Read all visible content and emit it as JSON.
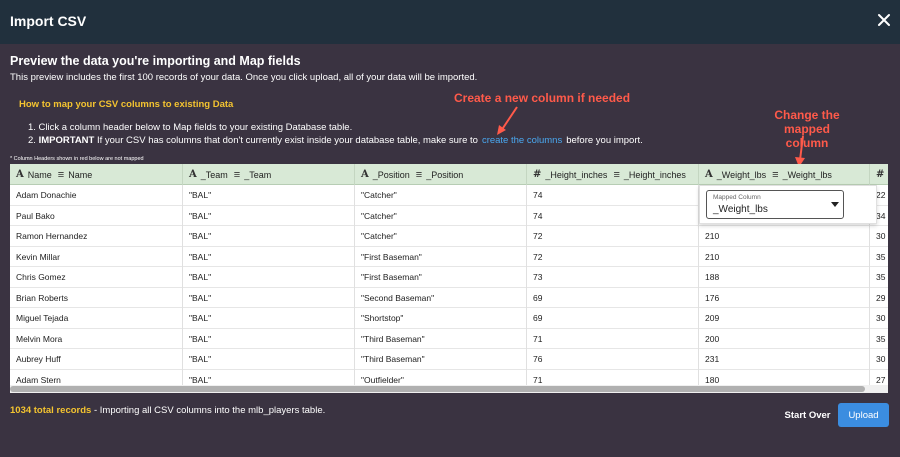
{
  "window": {
    "title": "Import CSV"
  },
  "header": {
    "heading": "Preview the data you're importing and Map fields",
    "subheading": "This preview includes the first 100 records of your data. Once you click upload, all of your data will be imported."
  },
  "instructions": {
    "title": "How to map your CSV columns to existing Data",
    "step1": "1. Click a column header below to Map fields to your existing Database table.",
    "step2_prefix": "2.",
    "step2_bold": "IMPORTANT",
    "step2_text": "If your CSV has columns that don't currently exist inside your database table, make sure to",
    "step2_link": "create the columns",
    "step2_suffix": "before you import.",
    "note": "* Column Headers shown in red below are not mapped"
  },
  "annotations": {
    "create_column": "Create a new column if needed",
    "change_mapped_line1": "Change the",
    "change_mapped_line2": "mapped column",
    "accent_color": "#ff5a4a"
  },
  "table": {
    "columns": [
      {
        "type_icon": "A",
        "name": "Name",
        "mapped": "Name"
      },
      {
        "type_icon": "A",
        "name": "_Team",
        "mapped": "_Team"
      },
      {
        "type_icon": "A",
        "name": "_Position",
        "mapped": "_Position"
      },
      {
        "type_icon": "#",
        "name": "_Height_inches",
        "mapped": "_Height_inches"
      },
      {
        "type_icon": "A",
        "name": "_Weight_lbs",
        "mapped": "_Weight_lbs"
      },
      {
        "type_icon": "#",
        "name": "",
        "mapped": ""
      }
    ],
    "rows": [
      [
        "Adam Donachie",
        "\"BAL\"",
        "\"Catcher\"",
        "74",
        "",
        "22"
      ],
      [
        "Paul Bako",
        "\"BAL\"",
        "\"Catcher\"",
        "74",
        "",
        "34"
      ],
      [
        "Ramon Hernandez",
        "\"BAL\"",
        "\"Catcher\"",
        "72",
        "210",
        "30"
      ],
      [
        "Kevin Millar",
        "\"BAL\"",
        "\"First Baseman\"",
        "72",
        "210",
        "35"
      ],
      [
        "Chris Gomez",
        "\"BAL\"",
        "\"First Baseman\"",
        "73",
        "188",
        "35"
      ],
      [
        "Brian Roberts",
        "\"BAL\"",
        "\"Second Baseman\"",
        "69",
        "176",
        "29"
      ],
      [
        "Miguel Tejada",
        "\"BAL\"",
        "\"Shortstop\"",
        "69",
        "209",
        "30"
      ],
      [
        "Melvin Mora",
        "\"BAL\"",
        "\"Third Baseman\"",
        "71",
        "200",
        "35"
      ],
      [
        "Aubrey Huff",
        "\"BAL\"",
        "\"Third Baseman\"",
        "76",
        "231",
        "30"
      ],
      [
        "Adam Stern",
        "\"BAL\"",
        "\"Outfielder\"",
        "71",
        "180",
        "27"
      ]
    ],
    "header_bg": "#d8e9d6"
  },
  "mapping_popup": {
    "label": "Mapped Column",
    "value": "_Weight_lbs"
  },
  "footer": {
    "record_count": "1034 total records",
    "text": " - Importing all CSV columns into the mlb_players table.",
    "start_over_label": "Start Over",
    "upload_label": "Upload",
    "upload_color": "#3b8de0"
  }
}
